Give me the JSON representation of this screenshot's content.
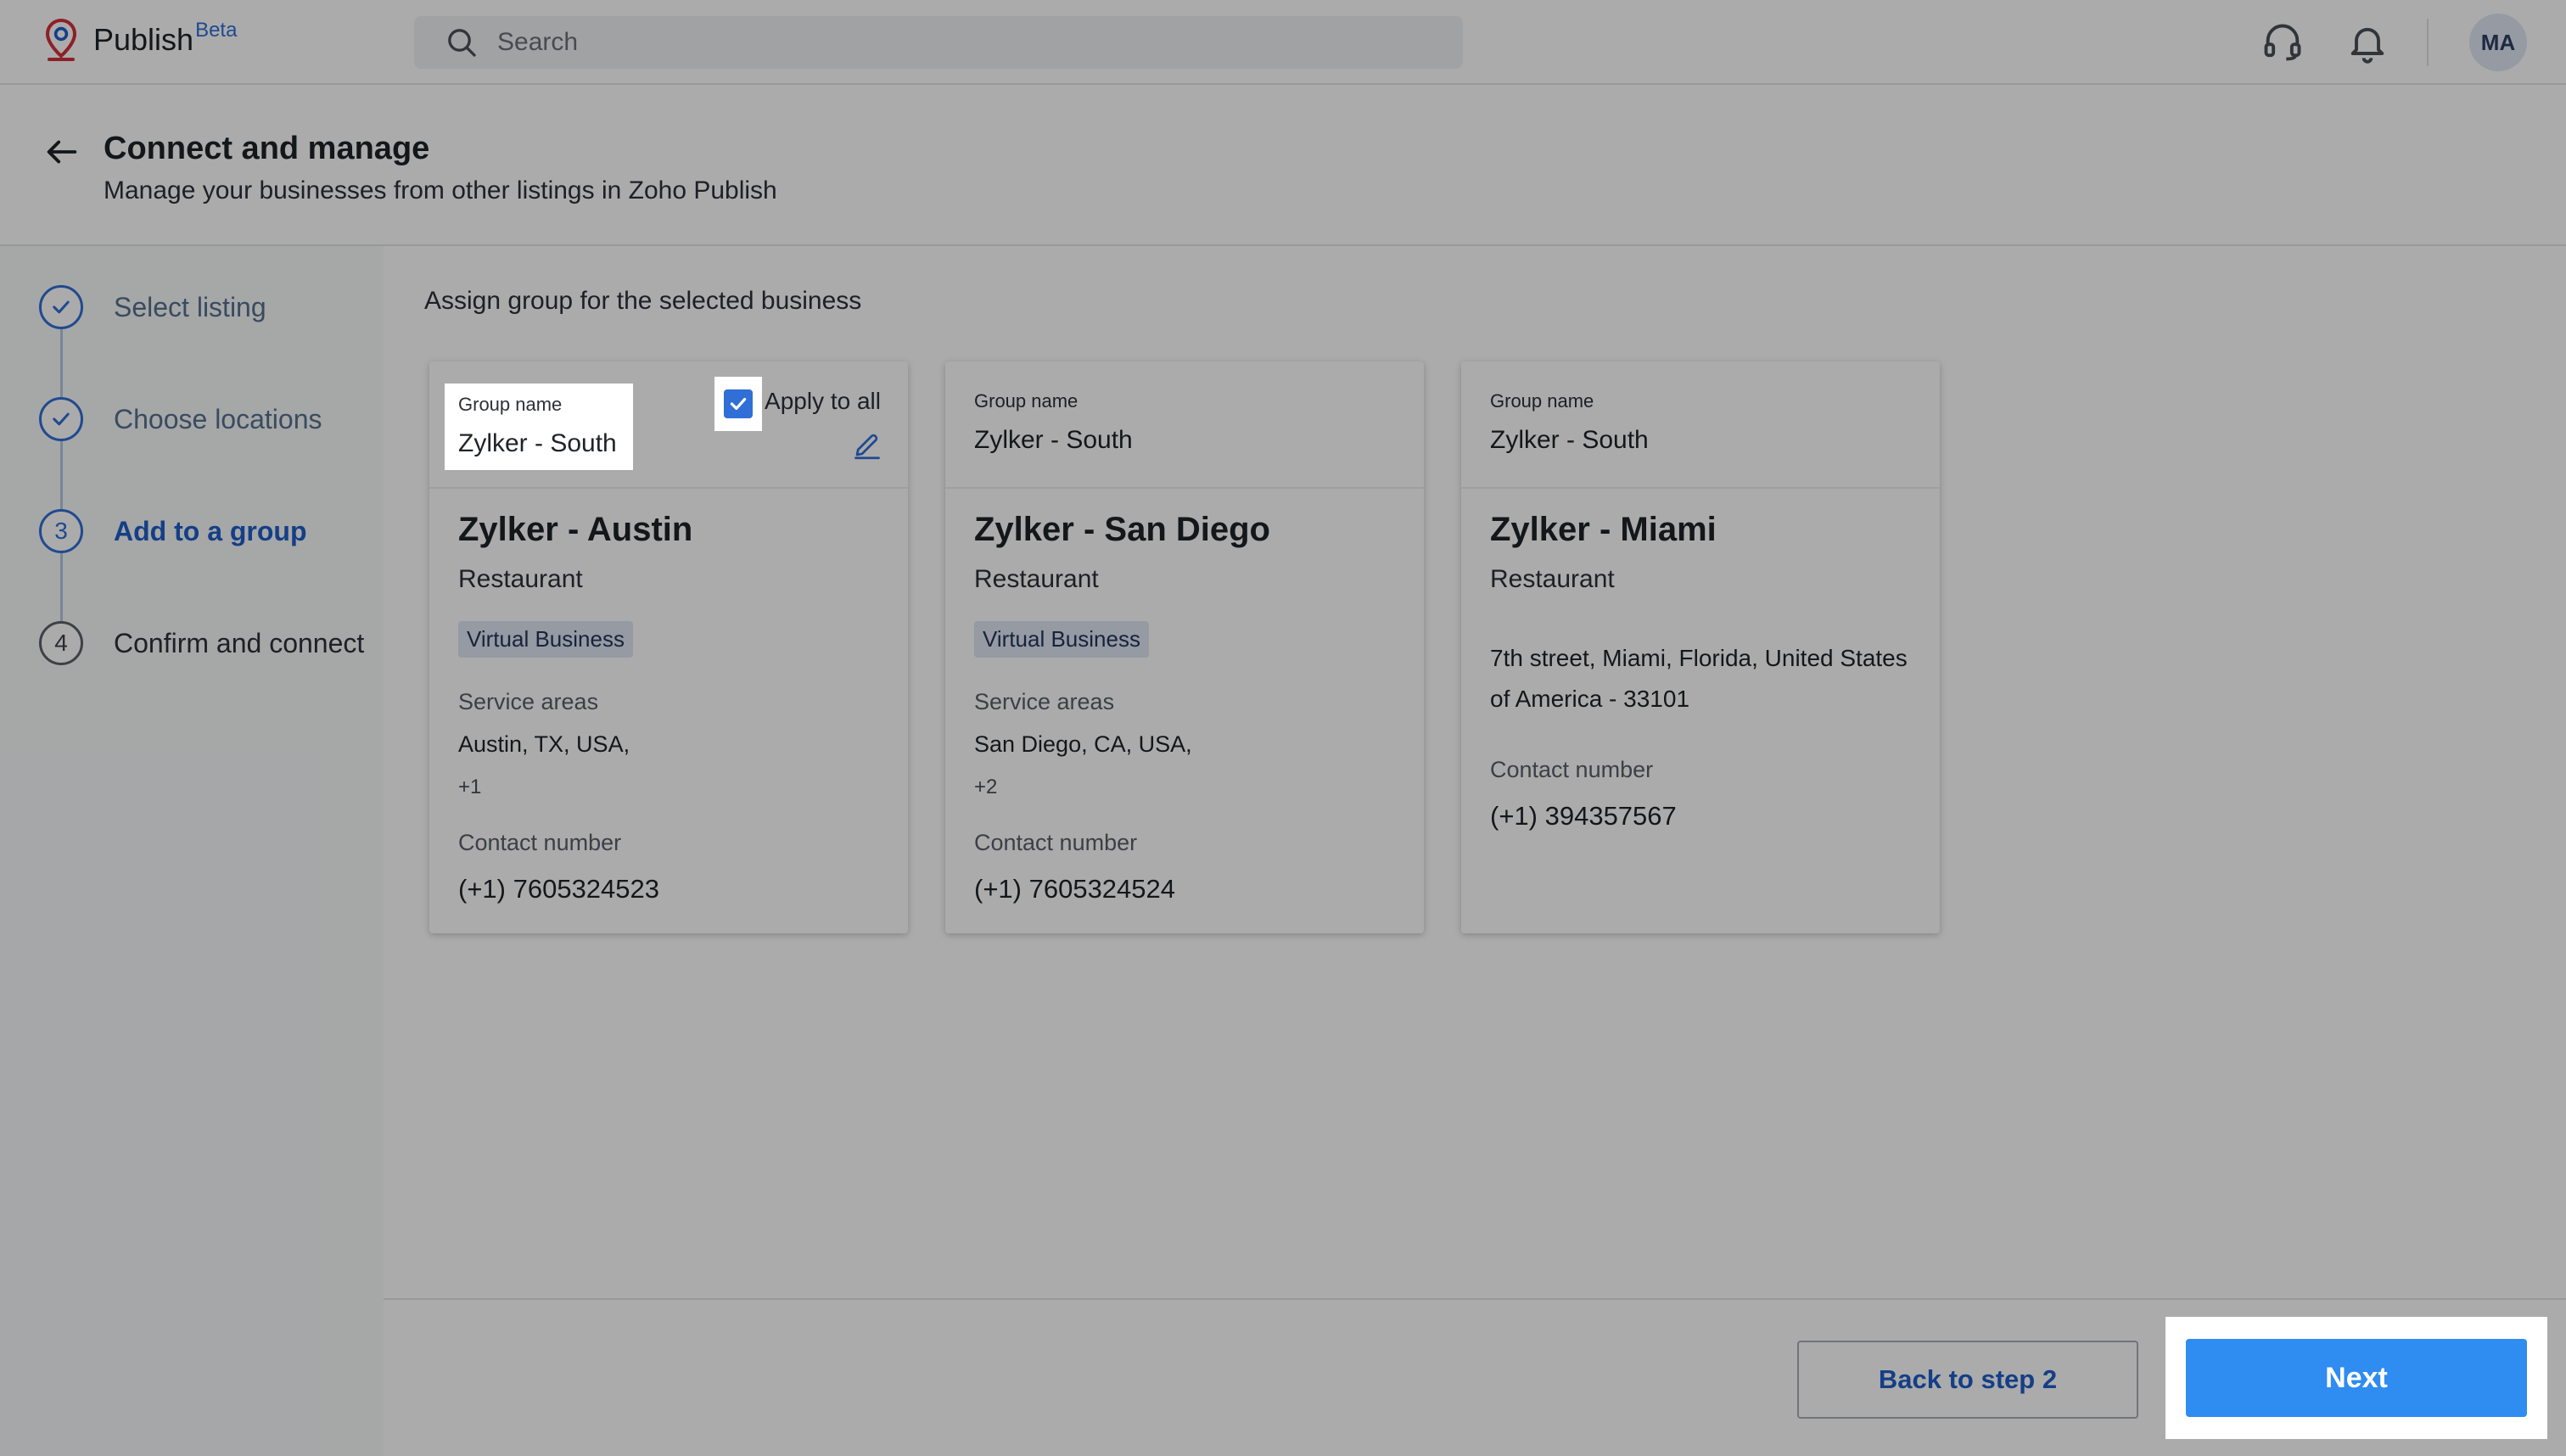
{
  "header": {
    "app_name": "Publish",
    "app_badge": "Beta",
    "search_placeholder": "Search",
    "avatar_initials": "MA",
    "icons": [
      "publish-logo-icon",
      "search-icon",
      "headset-icon",
      "bell-icon"
    ]
  },
  "page": {
    "title": "Connect and manage",
    "subtitle": "Manage your businesses from other listings in Zoho Publish"
  },
  "steps": [
    {
      "number": "1",
      "label": "Select listing",
      "state": "done"
    },
    {
      "number": "2",
      "label": "Choose locations",
      "state": "done"
    },
    {
      "number": "3",
      "label": "Add to a group",
      "state": "active"
    },
    {
      "number": "4",
      "label": "Confirm and connect",
      "state": "pending"
    }
  ],
  "main": {
    "title": "Assign group for the selected business",
    "apply_all_label": "Apply to all",
    "apply_all_checked": true,
    "cards": [
      {
        "group_label": "Group name",
        "group_value": "Zylker - South",
        "name": "Zylker - Austin",
        "category": "Restaurant",
        "badge": "Virtual Business",
        "service_label": "Service areas",
        "service_value": "Austin, TX, USA,",
        "service_more": "+1",
        "contact_label": "Contact number",
        "contact_value": "(+1) 7605324523"
      },
      {
        "group_label": "Group name",
        "group_value": "Zylker - South",
        "name": "Zylker - San Diego",
        "category": "Restaurant",
        "badge": "Virtual Business",
        "service_label": "Service areas",
        "service_value": "San Diego, CA, USA,",
        "service_more": "+2",
        "contact_label": "Contact number",
        "contact_value": "(+1) 7605324524"
      },
      {
        "group_label": "Group name",
        "group_value": "Zylker - South",
        "name": "Zylker - Miami",
        "category": "Restaurant",
        "address": "7th street, Miami, Florida, United States of America - 33101",
        "contact_label": "Contact number",
        "contact_value": "(+1) 394357567"
      }
    ]
  },
  "footer": {
    "back_label": "Back to step 2",
    "next_label": "Next"
  },
  "colors": {
    "accent": "#2f6fd6",
    "next_button": "#2f8cf0",
    "badge_bg": "#dfe6f3"
  }
}
